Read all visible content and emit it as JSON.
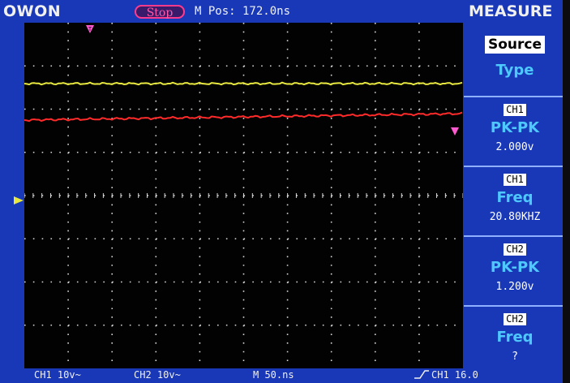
{
  "header": {
    "brand": "OWON",
    "run_state": "Stop",
    "mpos": "M Pos: 172.0ns",
    "menu_title": "MEASURE"
  },
  "panel": {
    "source": "Source",
    "type": "Type",
    "measurements": [
      {
        "channel": "CH1",
        "type": "PK-PK",
        "value": "2.000v"
      },
      {
        "channel": "CH1",
        "type": "Freq",
        "value": "20.80KHZ"
      },
      {
        "channel": "CH2",
        "type": "PK-PK",
        "value": "1.200v"
      },
      {
        "channel": "CH2",
        "type": "Freq",
        "value": "?"
      }
    ]
  },
  "footer": {
    "ch1_scale": "CH1 10v~",
    "ch2_scale": "CH2 10v~",
    "timebase": "M 50.ns",
    "trigger": "CH1 16.0"
  },
  "colors": {
    "ch1": "#e8e840",
    "ch2": "#ff2a2a",
    "screen_bg": "#1838b8",
    "panel_accent": "#4ec8ff",
    "stop": "#ff3a8c"
  }
}
